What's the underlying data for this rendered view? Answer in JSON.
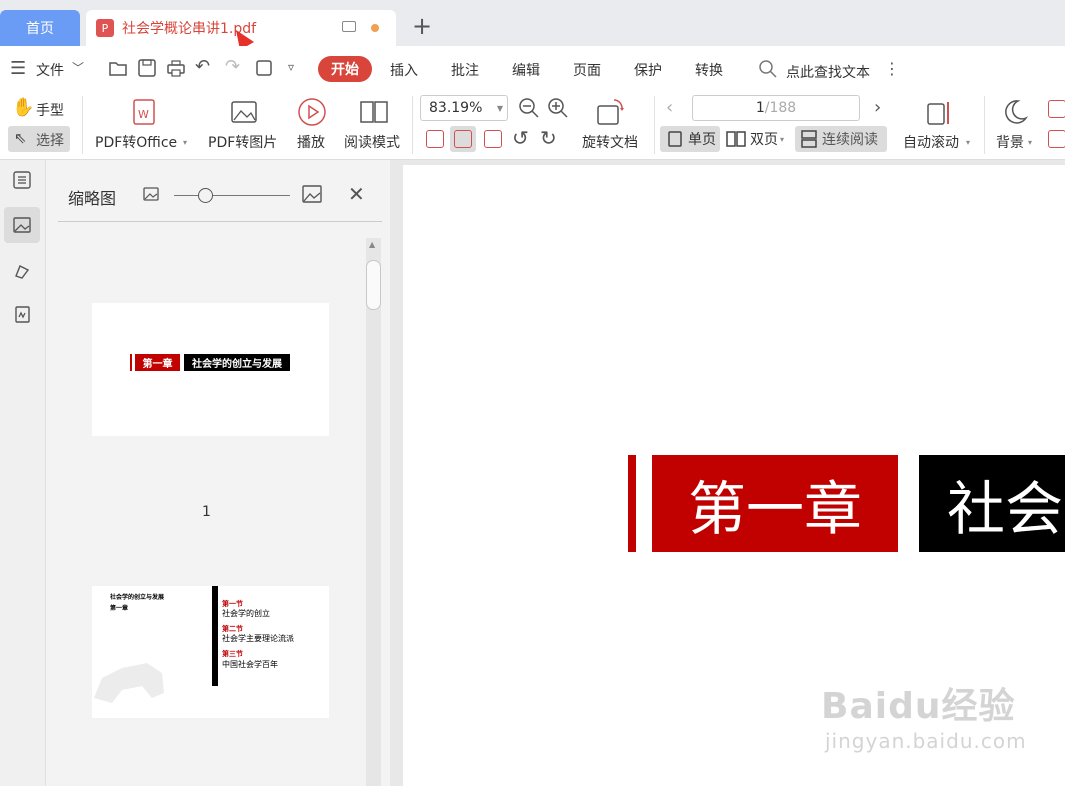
{
  "tabs": {
    "home": "首页",
    "document": "社会学概论串讲1.pdf"
  },
  "menu": {
    "file": "文件",
    "start": "开始",
    "insert": "插入",
    "annotate": "批注",
    "edit": "编辑",
    "page": "页面",
    "protect": "保护",
    "convert": "转换",
    "search": "点此查找文本"
  },
  "ribbon": {
    "hand_tool": "手型",
    "select_tool": "选择",
    "pdf_to_office": "PDF转Office",
    "pdf_to_image": "PDF转图片",
    "play": "播放",
    "reading_mode": "阅读模式",
    "zoom": "83.19%",
    "rotate_doc": "旋转文档",
    "page_current": "1",
    "page_total": "/188",
    "single_page": "单页",
    "double_page": "双页",
    "continuous": "连续阅读",
    "auto_scroll": "自动滚动",
    "background": "背景"
  },
  "thumbnail_panel": {
    "title": "缩略图",
    "page_number": "1",
    "thumb1": {
      "red_label": "第一章",
      "black_label": "社会学的创立与发展"
    },
    "thumb2": {
      "top_title": "社会学的创立与发展",
      "chapter": "第一章",
      "sections": [
        {
          "label": "第一节",
          "title": "社会学的创立"
        },
        {
          "label": "第二节",
          "title": "社会学主要理论流派"
        },
        {
          "label": "第三节",
          "title": "中国社会学百年"
        }
      ]
    }
  },
  "document": {
    "chapter_label": "第一章",
    "title_fragment": "社会"
  },
  "watermark": {
    "main": "Baidu经验",
    "sub": "jingyan.baidu.com"
  },
  "colors": {
    "accent": "#d9443b",
    "home_tab": "#6a9cf5",
    "doc_red": "#c10000"
  }
}
